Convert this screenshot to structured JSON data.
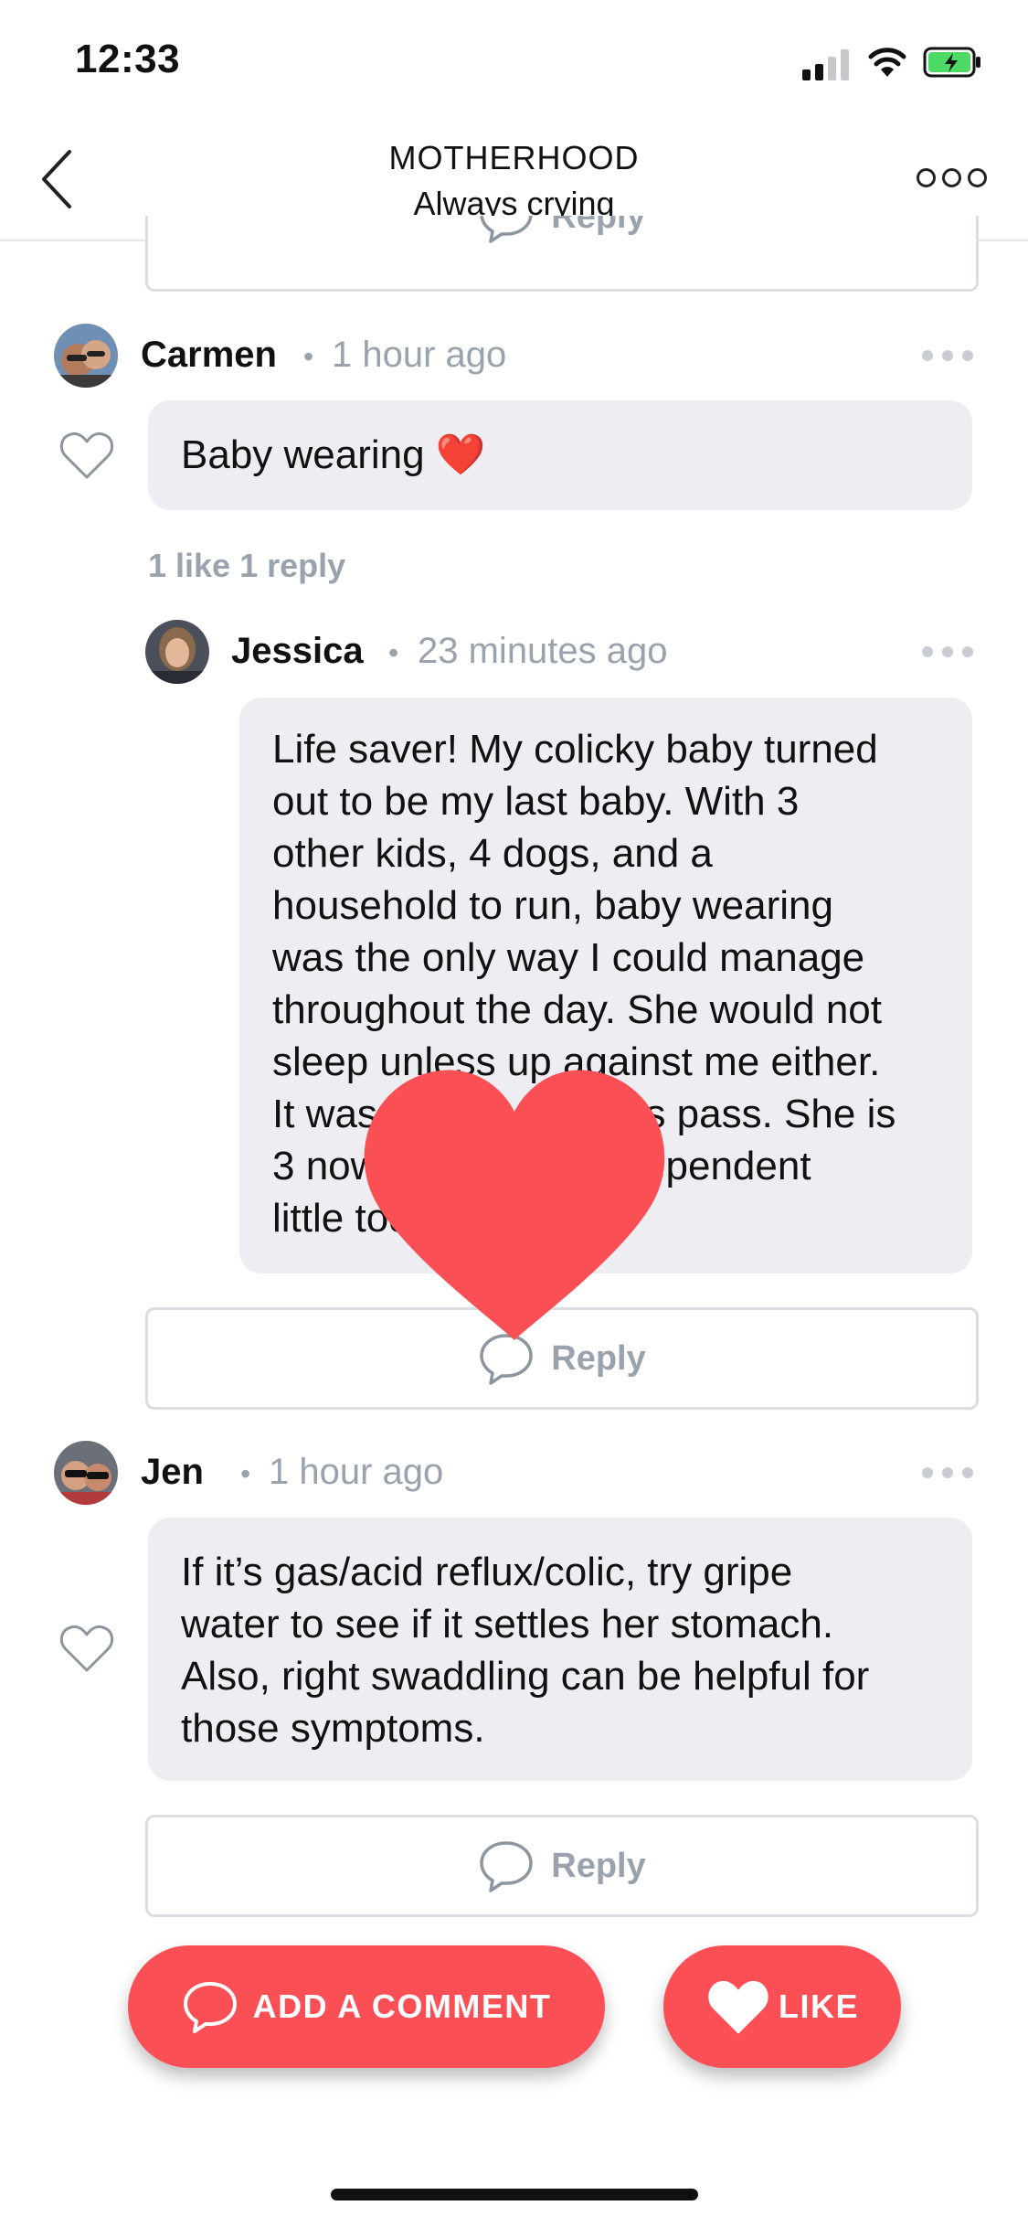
{
  "status_bar": {
    "time": "12:33"
  },
  "header": {
    "title": "MOTHERHOOD",
    "subtitle": "Always crying"
  },
  "top_reply": {
    "label": "Reply"
  },
  "comments": [
    {
      "author": "Carmen",
      "time": "1 hour ago",
      "text": "Baby wearing ❤️",
      "stats": "1 like 1 reply",
      "reply": {
        "author": "Jessica",
        "time": "23 minutes ago",
        "text_lines": [
          "Life saver! My colicky baby turned",
          "out to be my last baby. With 3",
          "other kids, 4 dogs, and a",
          "household to run, baby wearing",
          "was the only way I could manage",
          "throughout the day. She would not",
          "sleep unless up against me either.",
          "It was hard but it does pass. She is",
          "3 now and a very independent",
          "little toddler."
        ]
      },
      "reply_label": "Reply"
    },
    {
      "author": "Jen",
      "time": "1 hour ago",
      "text_lines": [
        "If it’s gas/acid reflux/colic, try gripe",
        "water to see if it settles her stomach.",
        "Also, right swaddling can be helpful for",
        "those symptoms."
      ],
      "reply_label": "Reply"
    }
  ],
  "actions": {
    "add_comment": "ADD A COMMENT",
    "like": "LIKE"
  },
  "colors": {
    "accent": "#fa4f55",
    "bubble": "#eeeef2",
    "muted": "#9aa2ad"
  },
  "icons": [
    "back-chevron-icon",
    "more-icon",
    "heart-outline-icon",
    "speech-bubble-icon",
    "heart-filled-icon"
  ]
}
